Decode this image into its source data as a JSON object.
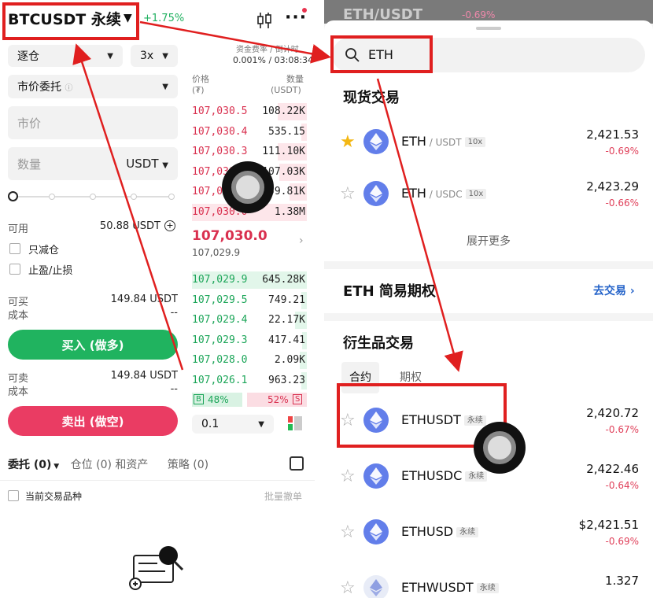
{
  "left": {
    "pair_title": "BTCUSDT 永续",
    "change": "+1.75%",
    "margin_mode": "逐仓",
    "leverage": "3x",
    "funding_label": "资金费率 / 倒计时",
    "funding_value": "0.001% / 03:08:34",
    "order_type": "市价委托",
    "price_placeholder": "市价",
    "qty_placeholder": "数量",
    "qty_unit": "USDT",
    "available_label": "可用",
    "available_value": "50.88 USDT",
    "reduce_only": "只减仓",
    "tp_sl": "止盈/止损",
    "can_buy_label": "可买",
    "can_buy_value": "149.84 USDT",
    "cost_label": "成本",
    "cost_value": "--",
    "buy_label": "买入 (做多)",
    "can_sell_label": "可卖",
    "can_sell_value": "149.84 USDT",
    "cost2_label": "成本",
    "cost2_value": "--",
    "sell_label": "卖出 (做空)",
    "orderbook": {
      "price_head": "价格",
      "price_unit": "(₮)",
      "qty_head": "数量",
      "qty_unit": "(USDT)",
      "asks": [
        {
          "p": "107,030.5",
          "q": "108.22K",
          "depth": 0.25
        },
        {
          "p": "107,030.4",
          "q": "535.15",
          "depth": 0.05
        },
        {
          "p": "107,030.3",
          "q": "111.10K",
          "depth": 0.25
        },
        {
          "p": "107,030.2",
          "q": "107.03K",
          "depth": 0.24
        },
        {
          "p": "107,030.1",
          "q": "59.81K",
          "depth": 0.15
        },
        {
          "p": "107,030.0",
          "q": "1.38M",
          "depth": 1.0
        }
      ],
      "mid_price": "107,030.0",
      "mark_price": "107,029.9",
      "bids": [
        {
          "p": "107,029.9",
          "q": "645.28K",
          "depth": 1.0
        },
        {
          "p": "107,029.5",
          "q": "749.21",
          "depth": 0.05
        },
        {
          "p": "107,029.4",
          "q": "22.17K",
          "depth": 0.1
        },
        {
          "p": "107,029.3",
          "q": "417.41",
          "depth": 0.04
        },
        {
          "p": "107,028.0",
          "q": "2.09K",
          "depth": 0.06
        },
        {
          "p": "107,026.1",
          "q": "963.23",
          "depth": 0.05
        }
      ],
      "buy_pct": "48%",
      "sell_pct": "52%",
      "buy_badge": "B",
      "sell_badge": "S",
      "precision": "0.1"
    },
    "tabs": {
      "orders": "委托 (0)",
      "positions": "仓位 (0) 和资产",
      "strategy": "策略 (0)"
    },
    "current_pair_only": "当前交易品种",
    "batch_cancel": "批量撤单"
  },
  "right": {
    "header_pair": "ETH/USDT",
    "header_change": "-0.69%",
    "search_value": "ETH",
    "spot_title": "现货交易",
    "spot": [
      {
        "base": "ETH",
        "quote": " / USDT",
        "lev": "10x",
        "price": "2,421.53",
        "chg": "-0.69%",
        "fav": true
      },
      {
        "base": "ETH",
        "quote": " / USDC",
        "lev": "10x",
        "price": "2,423.29",
        "chg": "-0.66%",
        "fav": false
      }
    ],
    "expand_more": "展开更多",
    "options_title": "ETH 简易期权",
    "go_trade": "去交易 ›",
    "deriv_title": "衍生品交易",
    "deriv_tabs": [
      "合约",
      "期权"
    ],
    "deriv": [
      {
        "name": "ETHUSDT",
        "tag": "永续",
        "price": "2,420.72",
        "chg": "-0.67%"
      },
      {
        "name": "ETHUSDC",
        "tag": "永续",
        "price": "2,422.46",
        "chg": "-0.64%"
      },
      {
        "name": "ETHUSD",
        "tag": "永续",
        "price": "$2,421.51",
        "chg": "-0.69%"
      },
      {
        "name": "ETHWUSDT",
        "tag": "永续",
        "price": "1.327",
        "chg": ""
      }
    ]
  }
}
